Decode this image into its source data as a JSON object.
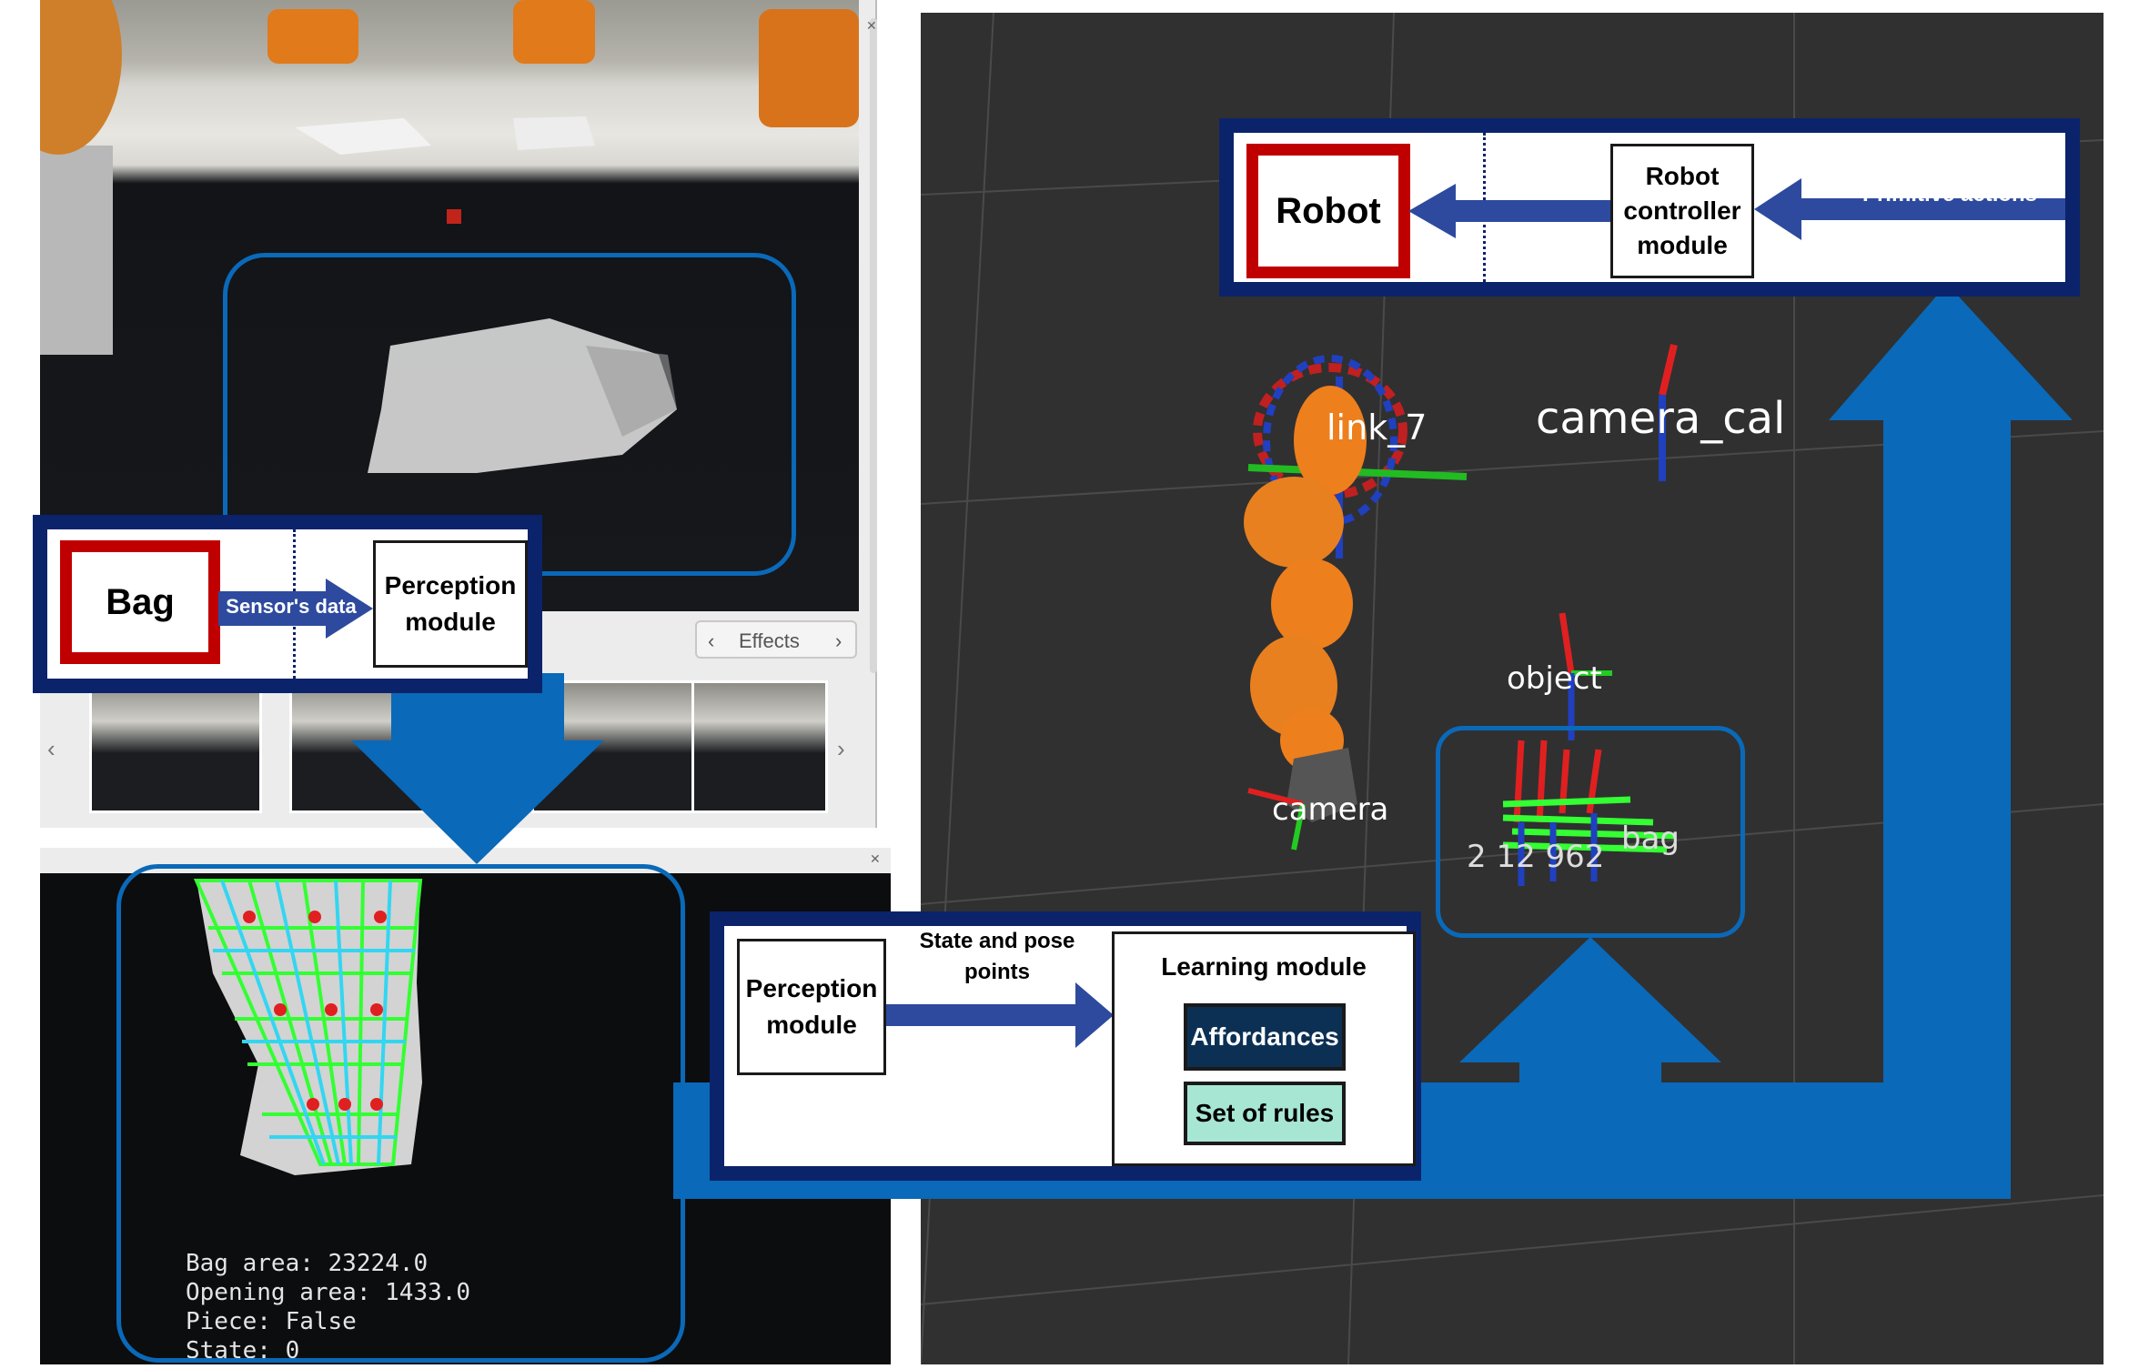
{
  "robot_box": {
    "robot_label": "Robot",
    "controller_label": "Robot controller module",
    "arrow_label": "Primitive actions"
  },
  "bag_box": {
    "bag_label": "Bag",
    "arrow_label": "Sensor's data",
    "perception_label": "Perception module"
  },
  "learning_box": {
    "perception_label": "Perception module",
    "arrow_label": "State and pose points",
    "learning_label": "Learning module",
    "affordances_label": "Affordances",
    "rules_label": "Set of rules"
  },
  "camera_window": {
    "effects_label": "Effects"
  },
  "perception_overlay": {
    "bag_area": "Bag area: 23224.0",
    "opening_area": "Opening area: 1433.0",
    "piece": "Piece: False",
    "state": "State: 0"
  },
  "rviz_labels": {
    "camera_cal": "camera_cal",
    "link7": "link_7",
    "object": "object",
    "camera": "camera",
    "bag": "bag",
    "number": "2 12 962"
  },
  "colors": {
    "flow_blue": "#0a69b8",
    "frame_navy": "#0b236b",
    "highlight_red": "#c00000",
    "affordances_fill": "#0c3054",
    "rules_fill": "#a8e6d4",
    "arrow_navy": "#2e4a9e",
    "robot_orange": "#ee7f1d",
    "mesh_green": "#33ff33",
    "mesh_cyan": "#33d6f0"
  }
}
